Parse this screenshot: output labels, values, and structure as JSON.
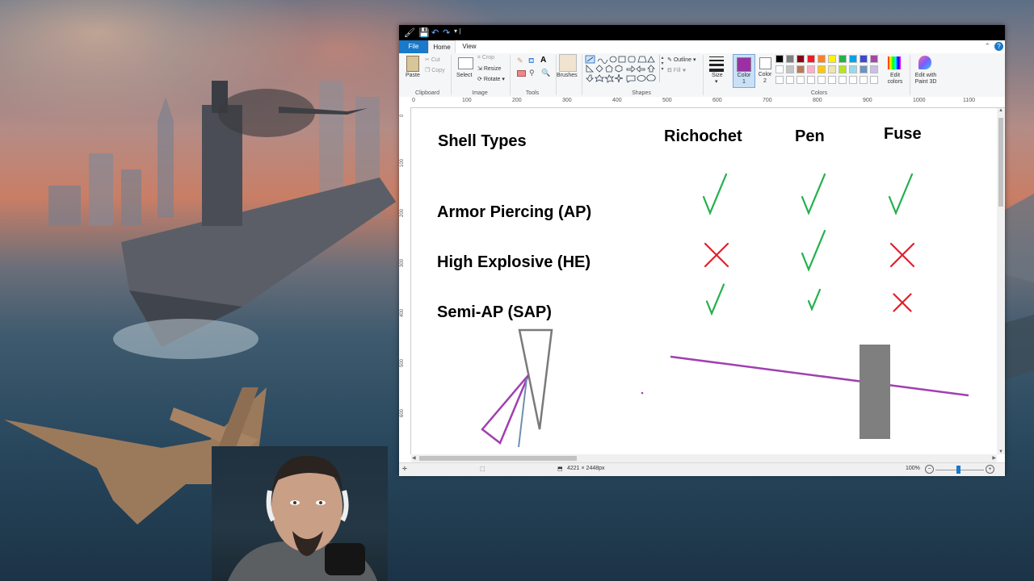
{
  "titlebar": {
    "quick_access": [
      "save",
      "undo",
      "redo"
    ]
  },
  "tabs": {
    "file": "File",
    "home": "Home",
    "view": "View"
  },
  "ribbon": {
    "clipboard": {
      "paste": "Paste",
      "cut": "Cut",
      "copy": "Copy",
      "label": "Clipboard"
    },
    "image": {
      "select": "Select",
      "crop": "Crop",
      "resize": "Resize",
      "rotate": "Rotate",
      "label": "Image"
    },
    "tools": {
      "label": "Tools"
    },
    "brushes": {
      "label": "Brushes"
    },
    "shapes": {
      "outline": "Outline",
      "fill": "Fill",
      "label": "Shapes"
    },
    "size": {
      "label": "Size"
    },
    "color1": {
      "label": "Color 1",
      "value": "#9b30a5"
    },
    "color2": {
      "label": "Color 2",
      "value": "#ffffff"
    },
    "colors": {
      "label": "Colors",
      "row1": [
        "#000000",
        "#7f7f7f",
        "#880015",
        "#ed1c24",
        "#ff7f27",
        "#fff200",
        "#22b14c",
        "#00a2e8",
        "#3f48cc",
        "#a349a4"
      ],
      "row2": [
        "#ffffff",
        "#c3c3c3",
        "#b97a57",
        "#ffaec9",
        "#ffc90e",
        "#efe4b0",
        "#b5e61d",
        "#99d9ea",
        "#7092be",
        "#c8bfe7"
      ],
      "row3": [
        "#ffffff",
        "#ffffff",
        "#ffffff",
        "#ffffff",
        "#ffffff",
        "#ffffff",
        "#ffffff",
        "#ffffff",
        "#ffffff",
        "#ffffff"
      ]
    },
    "edit_colors": "Edit colors",
    "paint3d": "Edit with Paint 3D"
  },
  "ruler_h": [
    "0",
    "100",
    "200",
    "300",
    "400",
    "500",
    "600",
    "700",
    "800",
    "900",
    "1000",
    "1100"
  ],
  "ruler_v": [
    "0",
    "100",
    "200",
    "300",
    "400",
    "500",
    "600"
  ],
  "canvas": {
    "title": "Shell Types",
    "columns": [
      "Richochet",
      "Pen",
      "Fuse"
    ],
    "rows": [
      "Armor Piercing (AP)",
      "High Explosive (HE)",
      "Semi-AP (SAP)"
    ],
    "marks": [
      [
        "check",
        "check",
        "check"
      ],
      [
        "cross",
        "check",
        "cross"
      ],
      [
        "check",
        "check",
        "cross"
      ]
    ],
    "check_color": "#22b14c",
    "cross_color": "#e0202c"
  },
  "status": {
    "dimensions": "4221 × 2448px",
    "zoom": "100%"
  }
}
